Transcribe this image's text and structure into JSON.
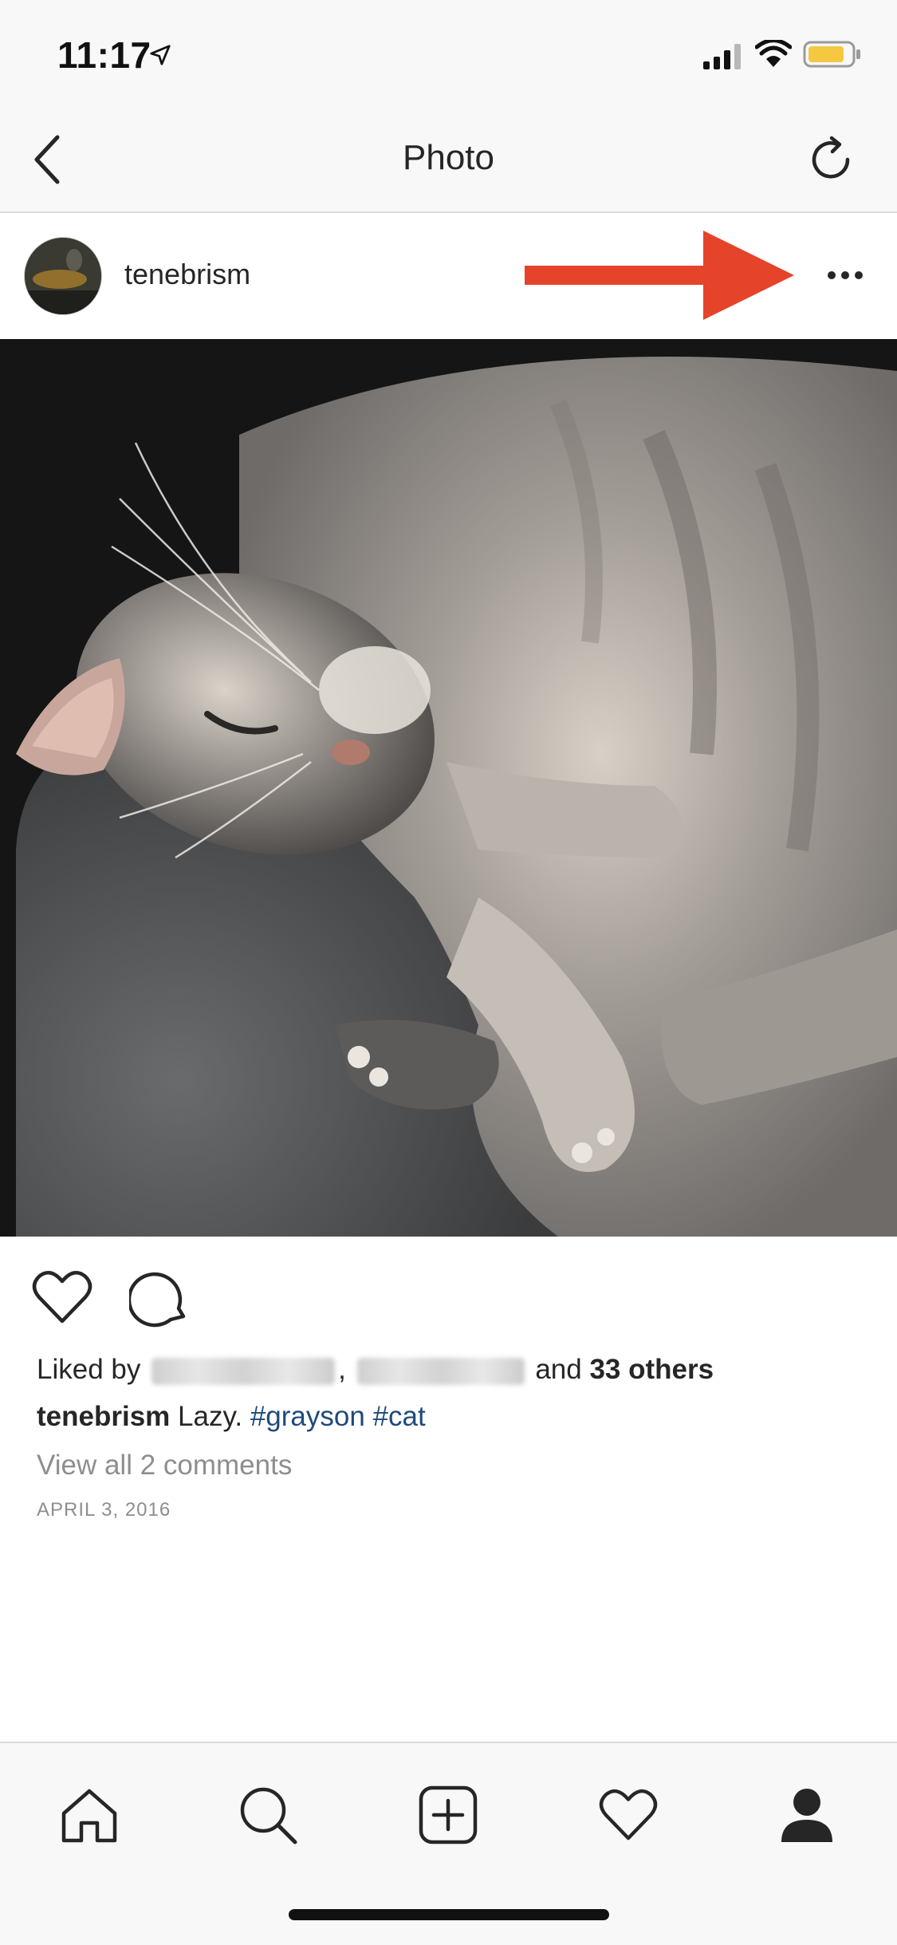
{
  "status_bar": {
    "time": "11:17",
    "icons": [
      "location-arrow-icon",
      "signal-bars-icon",
      "wifi-icon",
      "battery-icon"
    ],
    "battery_color": "#f5c842"
  },
  "nav": {
    "title": "Photo",
    "back_icon": "chevron-left-icon",
    "refresh_icon": "refresh-icon"
  },
  "post": {
    "username": "tenebrism",
    "more_icon": "more-dots-icon",
    "annotation_arrow_color": "#e5432a",
    "photo_alt": "sleeping gray cat",
    "actions": [
      "heart-icon",
      "comment-icon"
    ],
    "likes": {
      "prefix": "Liked by",
      "separator": ",",
      "suffix_and": "and",
      "others": "33 others"
    },
    "caption": {
      "user": "tenebrism",
      "text": "Lazy.",
      "tags": [
        "#grayson",
        "#cat"
      ],
      "hashtag_color": "#1f4a7a"
    },
    "view_comments": "View all 2 comments",
    "date": "APRIL 3, 2016"
  },
  "tab_bar": {
    "items": [
      "home-icon",
      "search-icon",
      "new-post-icon",
      "activity-heart-icon",
      "profile-icon"
    ],
    "active": "profile-icon"
  }
}
